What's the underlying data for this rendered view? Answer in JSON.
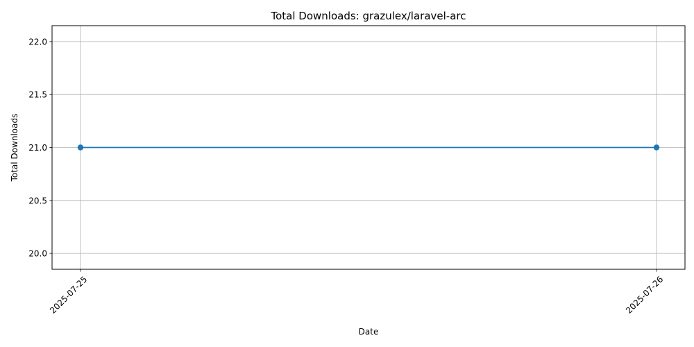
{
  "chart_data": {
    "type": "line",
    "title": "Total Downloads: grazulex/laravel-arc",
    "xlabel": "Date",
    "ylabel": "Total Downloads",
    "x": [
      "2025-07-25",
      "2025-07-26"
    ],
    "series": [
      {
        "values": [
          21,
          21
        ],
        "color": "#1f77b4",
        "marker": "circle"
      }
    ],
    "ylim": [
      19.85,
      22.15
    ],
    "yticks": [
      {
        "value": 20.0,
        "label": "20.0"
      },
      {
        "value": 20.5,
        "label": "20.5"
      },
      {
        "value": 21.0,
        "label": "21.0"
      },
      {
        "value": 21.5,
        "label": "21.5"
      },
      {
        "value": 22.0,
        "label": "22.0"
      }
    ],
    "grid": true,
    "legend": "none",
    "x_tick_rotation": "45 degrees"
  }
}
